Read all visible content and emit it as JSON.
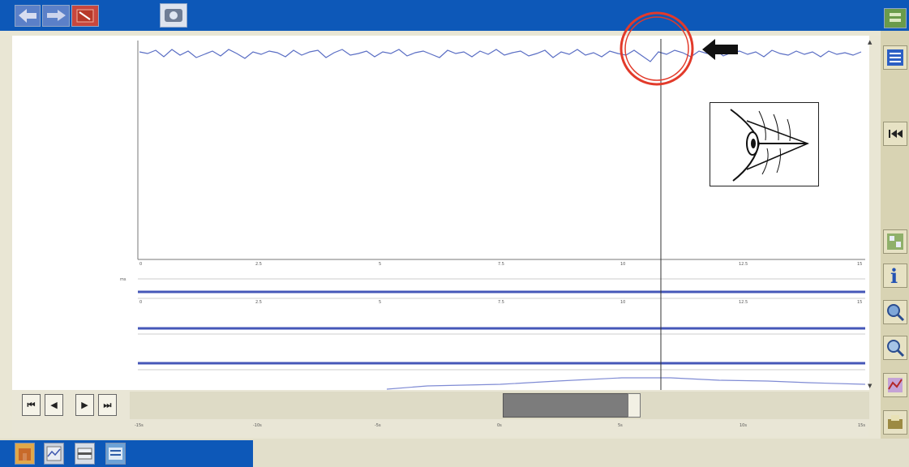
{
  "toolbar": {
    "back_icon": "back-arrow-icon",
    "forward_icon": "forward-arrow-icon",
    "tools_icon": "tools-icon",
    "scope_icon": "oscilloscope-icon",
    "corner_icon": "menu-toggle-icon"
  },
  "right_toolbar": [
    "list-icon",
    "rewind-to-start-icon",
    "chart-settings-icon",
    "help-icon",
    "zoom-in-icon",
    "zoom-out-icon",
    "graph-select-icon",
    "print-icon"
  ],
  "bottom_toolbar": [
    "home-icon",
    "graph-view-icon",
    "single-graph-icon",
    "data-list-icon"
  ],
  "playback": {
    "first_label": "⏮",
    "prev_label": "◀",
    "next_label": "▶",
    "last_label": "⏭"
  },
  "main_axis_ticks": [
    "0",
    "2.5",
    "5",
    "7.5",
    "10",
    "12.5",
    "15"
  ],
  "lower_axis_ticks": [
    "0",
    "2.5",
    "5",
    "7.5",
    "10",
    "12.5",
    "15"
  ],
  "timeline_ticks": [
    "-15s",
    "-10s",
    "-5s",
    "0s",
    "5s",
    "10s",
    "15s"
  ],
  "small_labels": {
    "unit_a": "ms"
  },
  "colors": {
    "accent": "#0d58b8",
    "trace": "#5a6ec4",
    "highlight": "#e23a2a"
  }
}
